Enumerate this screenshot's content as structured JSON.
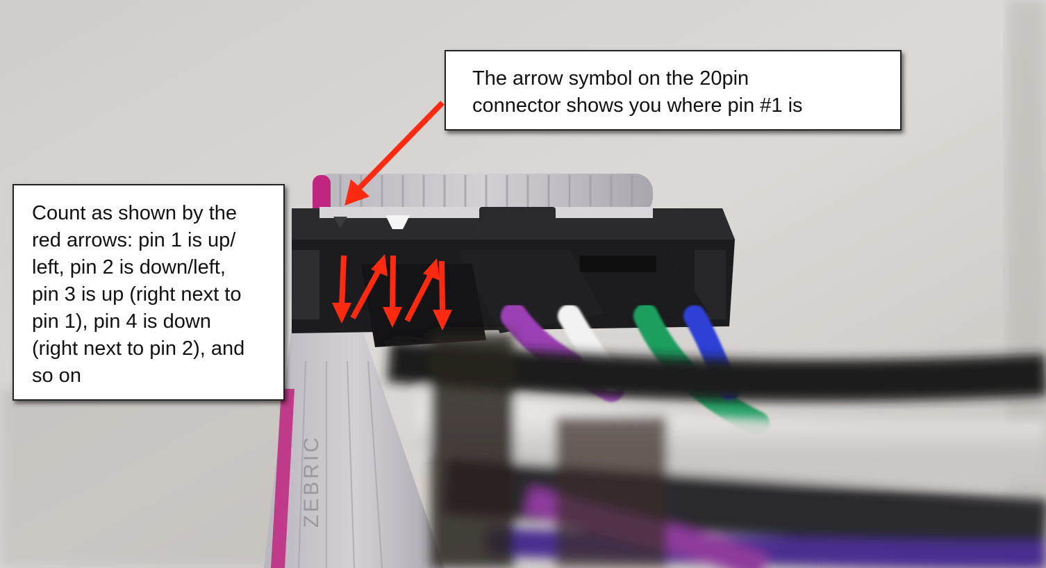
{
  "annotations": {
    "top_callout": {
      "lines": [
        "The arrow symbol on the 20pin",
        "connector shows you where pin #1 is"
      ]
    },
    "left_callout": {
      "lines": [
        "Count as shown by the",
        "red arrows: pin 1 is up/",
        "left, pin 2 is down/left,",
        "pin 3 is up (right next to",
        "pin 1), pin 4 is down",
        "(right next to pin 2), and",
        "so on"
      ]
    }
  },
  "cable_marking": "ZEBRIC",
  "colors": {
    "arrow_red": "#ff2a10",
    "ribbon_stripe": "#c0257f",
    "wire_purple": "#9b3fb5",
    "wire_white": "#f2f2f2",
    "wire_green": "#1f9e5e",
    "wire_blue": "#2f3fd6",
    "connector_black": "#1c1c1e",
    "ribbon_grey": "#c9c6cc"
  },
  "icons": [
    "pointer-arrow-icon",
    "pin-order-arrow-icon"
  ]
}
